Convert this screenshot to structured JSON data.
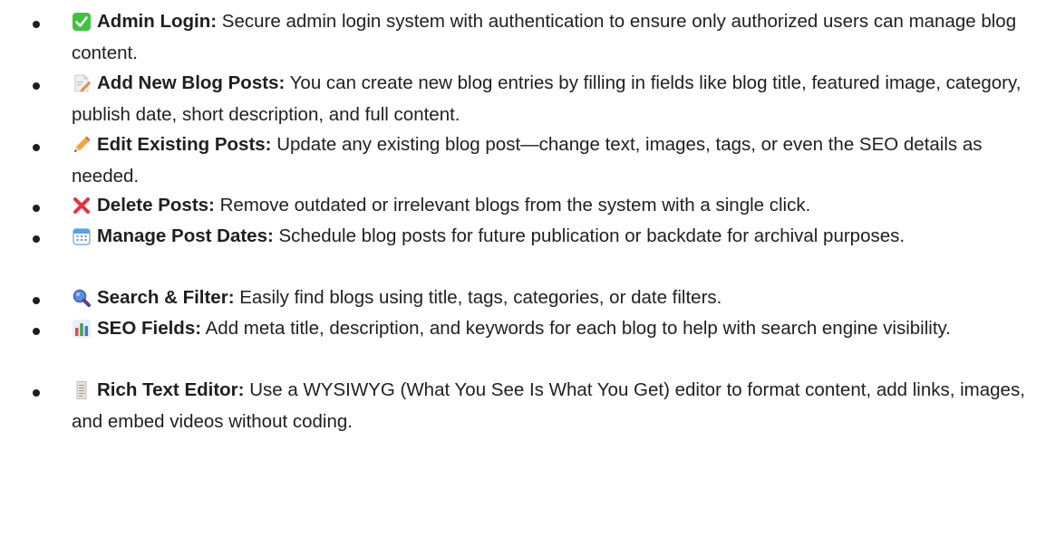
{
  "items": [
    {
      "icon": "check-box-icon",
      "title": "Admin Login:",
      "text": " Secure admin login system with authentication to ensure only authorized users can manage blog content."
    },
    {
      "icon": "memo-pencil-icon",
      "title": "Add New Blog Posts:",
      "text": " You can create new blog entries by filling in fields like blog title, featured image, category, publish date, short description, and full content."
    },
    {
      "icon": "pencil-icon",
      "title": "Edit Existing Posts:",
      "text": " Update any existing blog post—change text, images, tags, or even the SEO details as needed."
    },
    {
      "icon": "cross-mark-icon",
      "title": "Delete Posts:",
      "text": " Remove outdated or irrelevant blogs from the system with a single click."
    },
    {
      "icon": "calendar-icon",
      "title": "Manage Post Dates:",
      "text": " Schedule blog posts for future publication or backdate for archival purposes."
    },
    {
      "icon": "magnifier-icon",
      "title": "Search & Filter:",
      "text": " Easily find blogs using title, tags, categories, or date filters."
    },
    {
      "icon": "bar-chart-icon",
      "title": "SEO Fields:",
      "text": " Add meta title, description, and keywords for each blog to help with search engine visibility."
    },
    {
      "icon": "page-scroll-icon",
      "title": "Rich Text Editor:",
      "text": " Use a WYSIWYG (What You See Is What You Get) editor to format content, add links, images, and embed videos without coding."
    }
  ]
}
